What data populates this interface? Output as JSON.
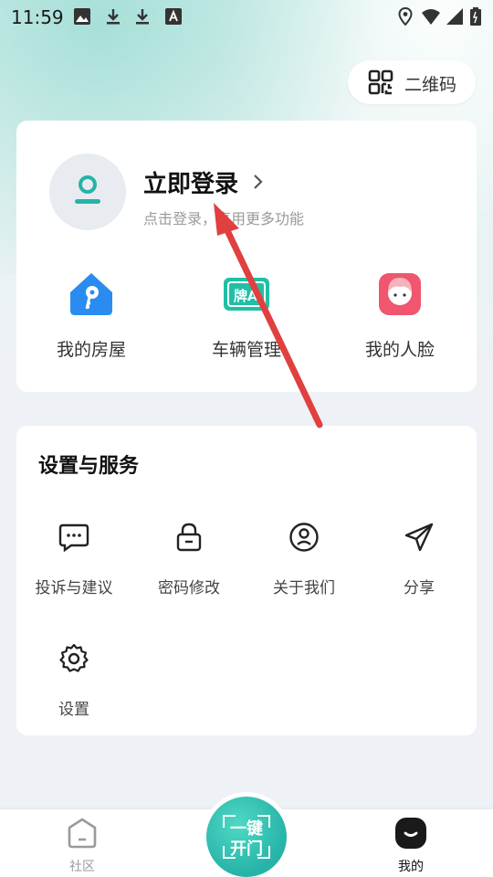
{
  "status_bar": {
    "time": "11:59",
    "left_icons": [
      "image-icon",
      "download-icon",
      "download-icon",
      "font-a-icon"
    ],
    "right_icons": [
      "location-icon",
      "wifi-icon",
      "signal-icon",
      "battery-icon"
    ]
  },
  "qr_button": {
    "label": "二维码",
    "icon": "qr-code-icon"
  },
  "profile": {
    "title": "立即登录",
    "subtitle": "点击登录，享用更多功能",
    "quick_actions": [
      {
        "label": "我的房屋",
        "icon": "house-key-icon",
        "color": "#2a8cf0"
      },
      {
        "label": "车辆管理",
        "icon": "license-plate-icon",
        "color": "#1fc0a6"
      },
      {
        "label": "我的人脸",
        "icon": "face-icon",
        "color": "#f0566e"
      }
    ]
  },
  "services": {
    "title": "设置与服务",
    "items": [
      {
        "label": "投诉与建议",
        "icon": "chat-bubble-icon"
      },
      {
        "label": "密码修改",
        "icon": "lock-icon"
      },
      {
        "label": "关于我们",
        "icon": "user-circle-icon"
      },
      {
        "label": "分享",
        "icon": "paper-plane-icon"
      },
      {
        "label": "设置",
        "icon": "gear-icon"
      }
    ]
  },
  "bottom_nav": {
    "community_label": "社区",
    "open_door_line1": "一键",
    "open_door_line2": "开门",
    "mine_label": "我的",
    "active": "我的"
  },
  "colors": {
    "accent": "#26b3a8",
    "arrow": "#e0403f"
  }
}
